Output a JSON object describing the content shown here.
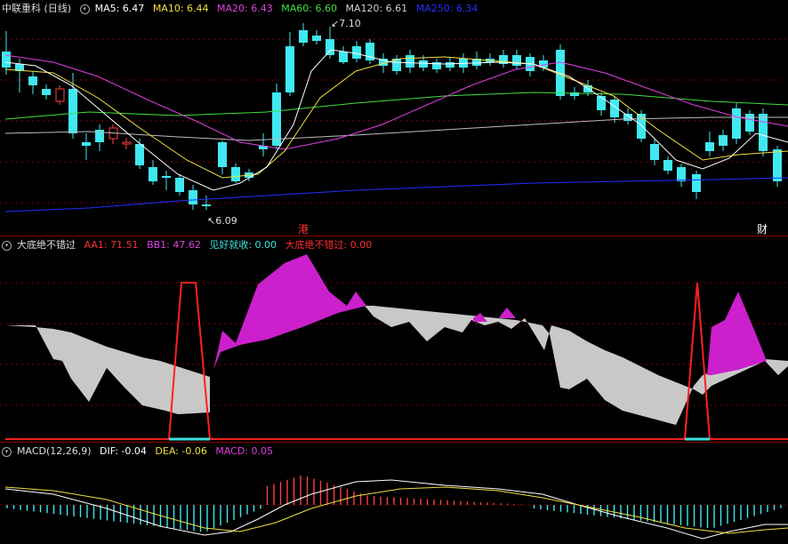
{
  "main": {
    "title": "中联重科 (日线)",
    "ma": [
      {
        "label": "MA5: 6.47",
        "color": "#ffffff"
      },
      {
        "label": "MA10: 6.44",
        "color": "#f0e040"
      },
      {
        "label": "MA20: 6.43",
        "color": "#e040e0"
      },
      {
        "label": "MA60: 6.60",
        "color": "#40e040"
      },
      {
        "label": "MA120: 6.61",
        "color": "#d0d0d0"
      },
      {
        "label": "MA250: 6.34",
        "color": "#2030ff"
      }
    ],
    "high_label": "7.10",
    "low_label": "6.09",
    "event_1": "港",
    "event_2": "财"
  },
  "indicator": {
    "name": "大底绝不错过",
    "items": [
      {
        "label": "AA1: 71.51",
        "color": "#ff3030"
      },
      {
        "label": "BB1: 47.62",
        "color": "#e040e0"
      },
      {
        "label": "见好就收: 0.00",
        "color": "#40e0e0"
      },
      {
        "label": "大底绝不错过: 0.00",
        "color": "#ff3030"
      }
    ]
  },
  "macd": {
    "name": "MACD(12,26,9)",
    "items": [
      {
        "label": "DIF: -0.04",
        "color": "#ffffff"
      },
      {
        "label": "DEA: -0.06",
        "color": "#f0e040"
      },
      {
        "label": "MACD: 0.05",
        "color": "#e040e0"
      }
    ]
  },
  "colors": {
    "up": "#ff4040",
    "down": "#40e8f0",
    "bg": "#000000",
    "grid": "#8a0000"
  }
}
